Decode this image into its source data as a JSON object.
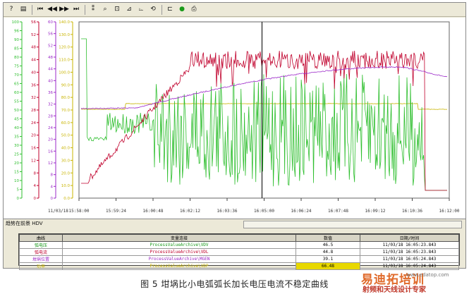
{
  "toolbar": {
    "buttons": [
      {
        "name": "help-icon",
        "glyph": "?"
      },
      {
        "name": "window-icon",
        "glyph": "▤"
      },
      {
        "name": "first-icon",
        "glyph": "⏮"
      },
      {
        "name": "rewind-icon",
        "glyph": "◀◀"
      },
      {
        "name": "forward-icon",
        "glyph": "▶▶"
      },
      {
        "name": "last-icon",
        "glyph": "⏭"
      },
      {
        "name": "ruler-icon",
        "glyph": "⁑"
      },
      {
        "name": "zoom-icon",
        "glyph": "⌕"
      },
      {
        "name": "zoom-area-icon",
        "glyph": "⊡"
      },
      {
        "name": "zoom-x-icon",
        "glyph": "⊿"
      },
      {
        "name": "zoom-y-icon",
        "glyph": "⌳"
      },
      {
        "name": "original-view-icon",
        "glyph": "⟲"
      },
      {
        "name": "select-curve-icon",
        "glyph": "⊏"
      },
      {
        "name": "start-stop-icon",
        "glyph": "●"
      },
      {
        "name": "print-icon",
        "glyph": "⎙"
      }
    ]
  },
  "axes": [
    {
      "color": "#2fbf2f",
      "ticks": [
        "100",
        "96",
        "90",
        "85",
        "80",
        "75",
        "70",
        "65",
        "60",
        "55",
        "50",
        "45",
        "40",
        "35",
        "30",
        "25",
        "20",
        "15",
        "10",
        "5",
        "0"
      ]
    },
    {
      "color": "#c0002c",
      "ticks": [
        "56",
        "52",
        "48",
        "44",
        "40",
        "36",
        "32",
        "28",
        "24",
        "20",
        "16",
        "12",
        "8",
        "4",
        "0"
      ]
    },
    {
      "color": "#9b28c8",
      "ticks": [
        "60",
        "56",
        "52",
        "48",
        "44",
        "40",
        "36",
        "32",
        "28",
        "24",
        "20",
        "16",
        "12",
        "8",
        "4",
        "0"
      ]
    },
    {
      "color": "#c8b400",
      "ticks": [
        "140.0",
        "130.0",
        "120.0",
        "110.0",
        "100.0",
        "90.0",
        "80.0",
        "70.0",
        "60.0",
        "50.0",
        "40.0",
        "30.0",
        "20.0",
        "10.0",
        "0.0"
      ]
    }
  ],
  "x_axis": {
    "date_label": "11/03/18",
    "time_labels": [
      "15:58:00",
      "15:59:24",
      "16:00:48",
      "16:02:12",
      "16:03:36",
      "16:05:00",
      "16:06:24",
      "16:07:48",
      "16:09:12",
      "16:10:36",
      "16:12:00"
    ]
  },
  "chart_data": {
    "type": "line",
    "x_unit": "time",
    "series": [
      {
        "name": "弧电压",
        "color": "#2fbf2f",
        "axis": 0
      },
      {
        "name": "弧电流",
        "color": "#c0002c",
        "axis": 1
      },
      {
        "name": "坩埚位置",
        "color": "#9b28c8",
        "axis": 2
      },
      {
        "name": "功率",
        "color": "#c8b400",
        "axis": 3
      }
    ],
    "cursor_time": "16:05:00"
  },
  "status": {
    "left": "趋势在前景 HDV"
  },
  "table": {
    "headers": [
      "曲线",
      "变量连接",
      "数值",
      "日期/时间"
    ],
    "rows": [
      {
        "name": "弧电压",
        "link": "ProcessValueArchive\\VDV",
        "value": "46.5",
        "time": "11/03/18 16:05:23.843",
        "color": "#1a9a1a"
      },
      {
        "name": "弧电流",
        "link": "ProcessValueArchive\\VDL",
        "value": "44.8",
        "time": "11/03/18 16:05:23.843",
        "color": "#c0002c"
      },
      {
        "name": "坩埚位置",
        "link": "ProcessValueArchive\\MGEN",
        "value": "39.1",
        "time": "11/03/18 16:05:24.843",
        "color": "#9b28c8"
      },
      {
        "name": "功率",
        "link": "ProcessValueArchive\\VDP",
        "value": "66.48",
        "time": "11/03/18 16:05:24.843",
        "color": "#c8b400"
      }
    ]
  },
  "caption": "图 5   坩埚比小电弧弧长加长电压电流不稳定曲线",
  "watermark": {
    "main": "易迪拓培训",
    "sub": "射频和天线设计专家",
    "url": "www.edatop.com"
  }
}
